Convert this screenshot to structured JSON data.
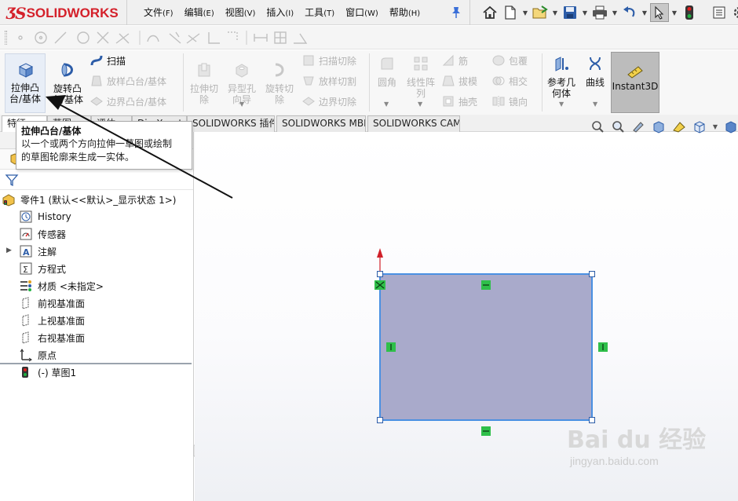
{
  "app": {
    "logo_text": "SOLIDWORKS",
    "menus": [
      {
        "label": "文件",
        "key": "(F)"
      },
      {
        "label": "编辑",
        "key": "(E)"
      },
      {
        "label": "视图",
        "key": "(V)"
      },
      {
        "label": "插入",
        "key": "(I)"
      },
      {
        "label": "工具",
        "key": "(T)"
      },
      {
        "label": "窗口",
        "key": "(W)"
      },
      {
        "label": "帮助",
        "key": "(H)"
      }
    ],
    "quick_access_icons": [
      "home-icon",
      "new-document-icon",
      "open-folder-icon",
      "save-icon",
      "print-icon",
      "undo-icon",
      "select-cursor-icon",
      "traffic-light-icon",
      "options-icon",
      "settings-icon"
    ]
  },
  "ribbon": {
    "extrude_boss": "拉伸凸台/基体",
    "extrude_line1": "拉伸凸",
    "extrude_line2": "台/基体",
    "revolve_line1": "旋转凸",
    "revolve_line2": "台/基体",
    "sweep": "扫描",
    "loft_boss": "放样凸台/基体",
    "boundary_boss": "边界凸台/基体",
    "extrude_cut_line1": "拉伸切",
    "extrude_cut_line2": "除",
    "hole_wizard_line1": "异型孔",
    "hole_wizard_line2": "向导",
    "revolve_cut_line1": "旋转切",
    "revolve_cut_line2": "除",
    "swept_cut": "扫描切除",
    "lofted_cut": "放样切割",
    "boundary_cut": "边界切除",
    "fillet": "圆角",
    "linear_pattern_line1": "线性阵",
    "linear_pattern_line2": "列",
    "rib": "筋",
    "draft": "拔模",
    "shell": "抽壳",
    "wrap": "包覆",
    "intersect": "相交",
    "mirror": "镜向",
    "ref_geometry_line1": "参考几",
    "ref_geometry_line2": "何体",
    "curves": "曲线",
    "instant3d": "Instant3D"
  },
  "tabs": [
    {
      "label": "特征",
      "active": true
    },
    {
      "label": "草图",
      "active": false
    },
    {
      "label": "评估",
      "active": false
    },
    {
      "label": "DimXpert",
      "active": false
    },
    {
      "label": "SOLIDWORKS 插件",
      "active": false
    },
    {
      "label": "SOLIDWORKS MBD",
      "active": false
    },
    {
      "label": "SOLIDWORKS CAM",
      "active": false
    }
  ],
  "tooltip": {
    "title": "拉伸凸台/基体",
    "line1": "以一个或两个方向拉伸一草图或绘制",
    "line2": "的草图轮廓来生成一实体。"
  },
  "tree": {
    "root": "零件1  (默认<<默认>_显示状态 1>)",
    "history": "History",
    "sensors": "传感器",
    "annotations": "注解",
    "equations": "方程式",
    "material": "材质 <未指定>",
    "front_plane": "前视基准面",
    "top_plane": "上视基准面",
    "right_plane": "右视基准面",
    "origin": "原点",
    "sketch": "(-) 草图1"
  },
  "sketch": {
    "fill_color": "#a9aacb",
    "edge_color": "#4a90e2",
    "relation_color": "#2fbf4a",
    "origin_arrow_color": "#d0202a"
  },
  "watermark": {
    "main": "Bai du 经验",
    "sub": "jingyan.baidu.com"
  },
  "colors": {
    "brand": "#d4202a",
    "annotation_arrow": "#111111"
  }
}
